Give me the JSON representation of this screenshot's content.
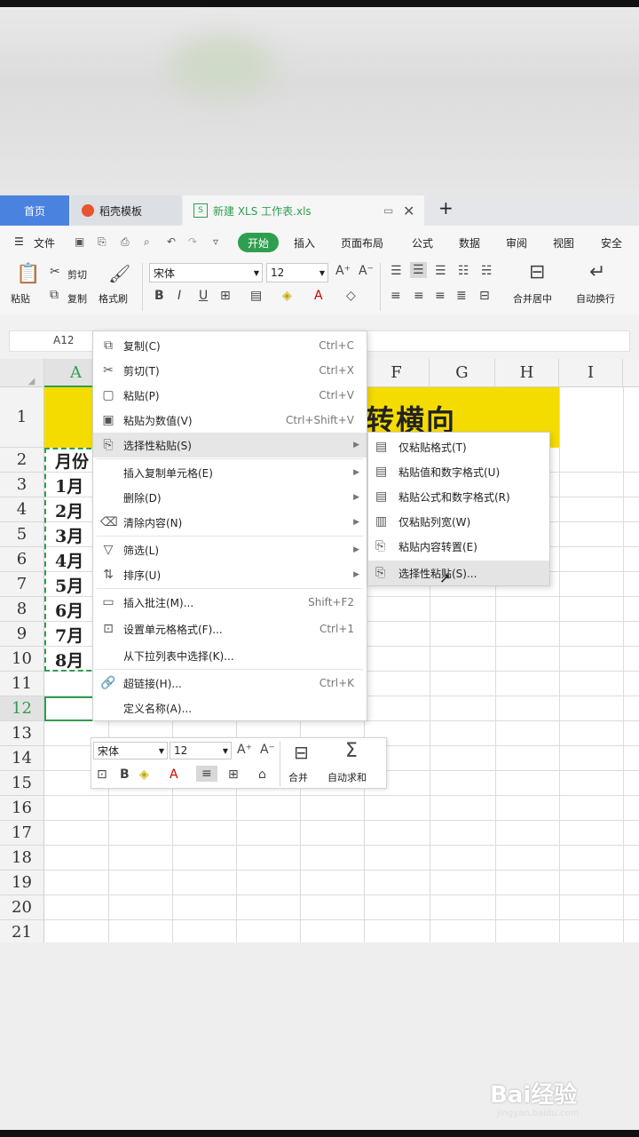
{
  "tabs": {
    "home": "首页",
    "template": "稻壳模板",
    "file": "新建 XLS 工作表.xls",
    "add": "+"
  },
  "menubar": {
    "file": "文件",
    "start": "开始",
    "items": [
      "插入",
      "页面布局",
      "公式",
      "数据",
      "审阅",
      "视图",
      "安全"
    ]
  },
  "ribbon": {
    "paste": "粘贴",
    "cut": "剪切",
    "copy": "复制",
    "format_painter": "格式刷",
    "font_name": "宋体",
    "font_size": "12",
    "merge_center": "合并居中",
    "wrap": "自动换行"
  },
  "formula": {
    "name_box": "A12"
  },
  "grid": {
    "columns": [
      "A",
      "F",
      "G",
      "H",
      "I"
    ],
    "rows": [
      "1",
      "2",
      "3",
      "4",
      "5",
      "6",
      "7",
      "8",
      "9",
      "10",
      "11",
      "12",
      "13",
      "14",
      "15",
      "16",
      "17",
      "18",
      "19",
      "20",
      "21"
    ],
    "title_fragment": "转横向",
    "col_a": [
      "月份",
      "1月",
      "2月",
      "3月",
      "4月",
      "5月",
      "6月",
      "7月",
      "8月"
    ]
  },
  "context_menu": [
    {
      "icon": "copy-icon",
      "label": "复制(C)",
      "shortcut": "Ctrl+C"
    },
    {
      "icon": "cut-icon",
      "label": "剪切(T)",
      "shortcut": "Ctrl+X"
    },
    {
      "icon": "paste-icon",
      "label": "粘贴(P)",
      "shortcut": "Ctrl+V"
    },
    {
      "icon": "paste-value-icon",
      "label": "粘贴为数值(V)",
      "shortcut": "Ctrl+Shift+V"
    },
    {
      "icon": "paste-special-icon",
      "label": "选择性粘贴(S)",
      "shortcut": ""
    },
    {
      "icon": "",
      "label": "插入复制单元格(E)",
      "shortcut": ""
    },
    {
      "icon": "",
      "label": "删除(D)",
      "shortcut": ""
    },
    {
      "icon": "eraser-icon",
      "label": "清除内容(N)",
      "shortcut": ""
    },
    {
      "icon": "filter-icon",
      "label": "筛选(L)",
      "shortcut": ""
    },
    {
      "icon": "sort-icon",
      "label": "排序(U)",
      "shortcut": ""
    },
    {
      "icon": "comment-icon",
      "label": "插入批注(M)...",
      "shortcut": "Shift+F2"
    },
    {
      "icon": "format-cells-icon",
      "label": "设置单元格格式(F)...",
      "shortcut": "Ctrl+1"
    },
    {
      "icon": "",
      "label": "从下拉列表中选择(K)...",
      "shortcut": ""
    },
    {
      "icon": "link-icon",
      "label": "超链接(H)...",
      "shortcut": "Ctrl+K"
    },
    {
      "icon": "",
      "label": "定义名称(A)...",
      "shortcut": ""
    }
  ],
  "submenu": [
    "仅粘贴格式(T)",
    "粘贴值和数字格式(U)",
    "粘贴公式和数字格式(R)",
    "仅粘贴列宽(W)",
    "粘贴内容转置(E)",
    "选择性粘贴(S)..."
  ],
  "mini_toolbar": {
    "font_name": "宋体",
    "font_size": "12",
    "merge": "合并",
    "autosum": "自动求和"
  },
  "watermark": {
    "brand": "Bai经验",
    "url": "jingyan.baidu.com"
  },
  "colors": {
    "accent_green": "#2f9e4f",
    "tab_blue": "#4a82e0",
    "highlight_yellow": "#f5dc00"
  }
}
